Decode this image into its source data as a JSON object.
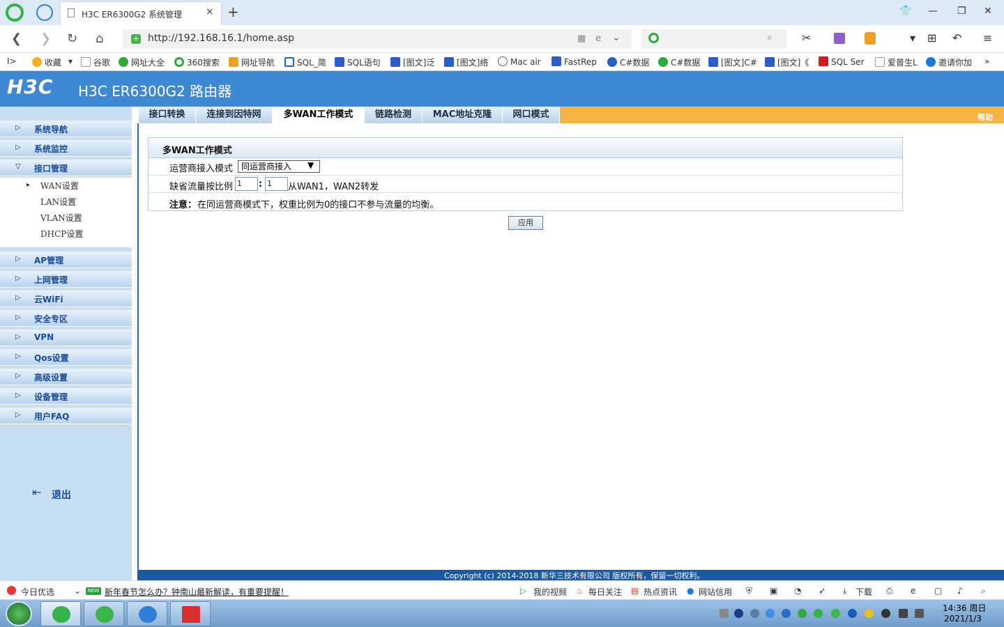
{
  "browser": {
    "tab_title": "H3C ER6300G2 系统管理",
    "tab_close": "×",
    "new_tab": "+",
    "url": "http://192.168.16.1/home.asp",
    "addr_shield": "+",
    "bookmarks": [
      "收藏",
      "谷歌",
      "网址大全",
      "360搜索",
      "网址导航",
      "SQL_简",
      "SQL语句",
      "[图文]泛",
      "[图文]络",
      "Mac air",
      "FastRep",
      "C#数据",
      "C#数据",
      "[图文]C#",
      "[图文]《",
      "SQL Ser",
      "爱普生L",
      "邀请你加",
      "»"
    ],
    "bookmark_toggle": "I>",
    "bookmark_dropdown": "▾"
  },
  "router": {
    "logo": "H3C",
    "title": "H3C ER6300G2 路由器",
    "help": "帮助",
    "menu": [
      {
        "label": "系统导航",
        "arrow": "▷"
      },
      {
        "label": "系统监控",
        "arrow": "▷"
      },
      {
        "label": "接口管理",
        "arrow": "▽"
      },
      {
        "label": "AP管理",
        "arrow": "▷"
      },
      {
        "label": "上网管理",
        "arrow": "▷"
      },
      {
        "label": "云WiFi",
        "arrow": "▷"
      },
      {
        "label": "安全专区",
        "arrow": "▷"
      },
      {
        "label": "VPN",
        "arrow": "▷"
      },
      {
        "label": "Qos设置",
        "arrow": "▷"
      },
      {
        "label": "高级设置",
        "arrow": "▷"
      },
      {
        "label": "设备管理",
        "arrow": "▷"
      },
      {
        "label": "用户FAQ",
        "arrow": "▷"
      }
    ],
    "submenu": [
      "WAN设置",
      "LAN设置",
      "VLAN设置",
      "DHCP设置"
    ],
    "submenu_arrow": "▸",
    "logout": "退出",
    "tabs": [
      "接口转换",
      "连接到因特网",
      "多WAN工作模式",
      "链路检测",
      "MAC地址克隆",
      "网口模式"
    ],
    "panel": {
      "title": "多WAN工作模式",
      "mode_label": "运营商接入模式",
      "mode_value": "同运营商接入",
      "ratio_label": "缺省流量按比例",
      "ratio_a": "1",
      "ratio_sep": ":",
      "ratio_b": "1",
      "ratio_suffix": "从WAN1，WAN2转发",
      "note_bold": "注意：",
      "note_text": "在同运营商模式下，权重比例为0的接口不参与流量的均衡。",
      "apply": "应用"
    },
    "copyright": "Copyright (c) 2014-2018 新华三技术有限公司 版权所有，保留一切权利。"
  },
  "statusbar": {
    "today": "今日优选",
    "badge": "NEW",
    "news": "新年春节怎么办？钟南山最新解读，有重要提醒！",
    "items": [
      "我的视频",
      "每日关注",
      "热点资讯",
      "网站信用",
      "下载"
    ]
  },
  "taskbar": {
    "time": "14:36 周日",
    "date": "2021/1/3"
  },
  "colors": {
    "header": "#3f89d2",
    "tabbar": "#f7b446",
    "sidebar": "#c8def2"
  }
}
